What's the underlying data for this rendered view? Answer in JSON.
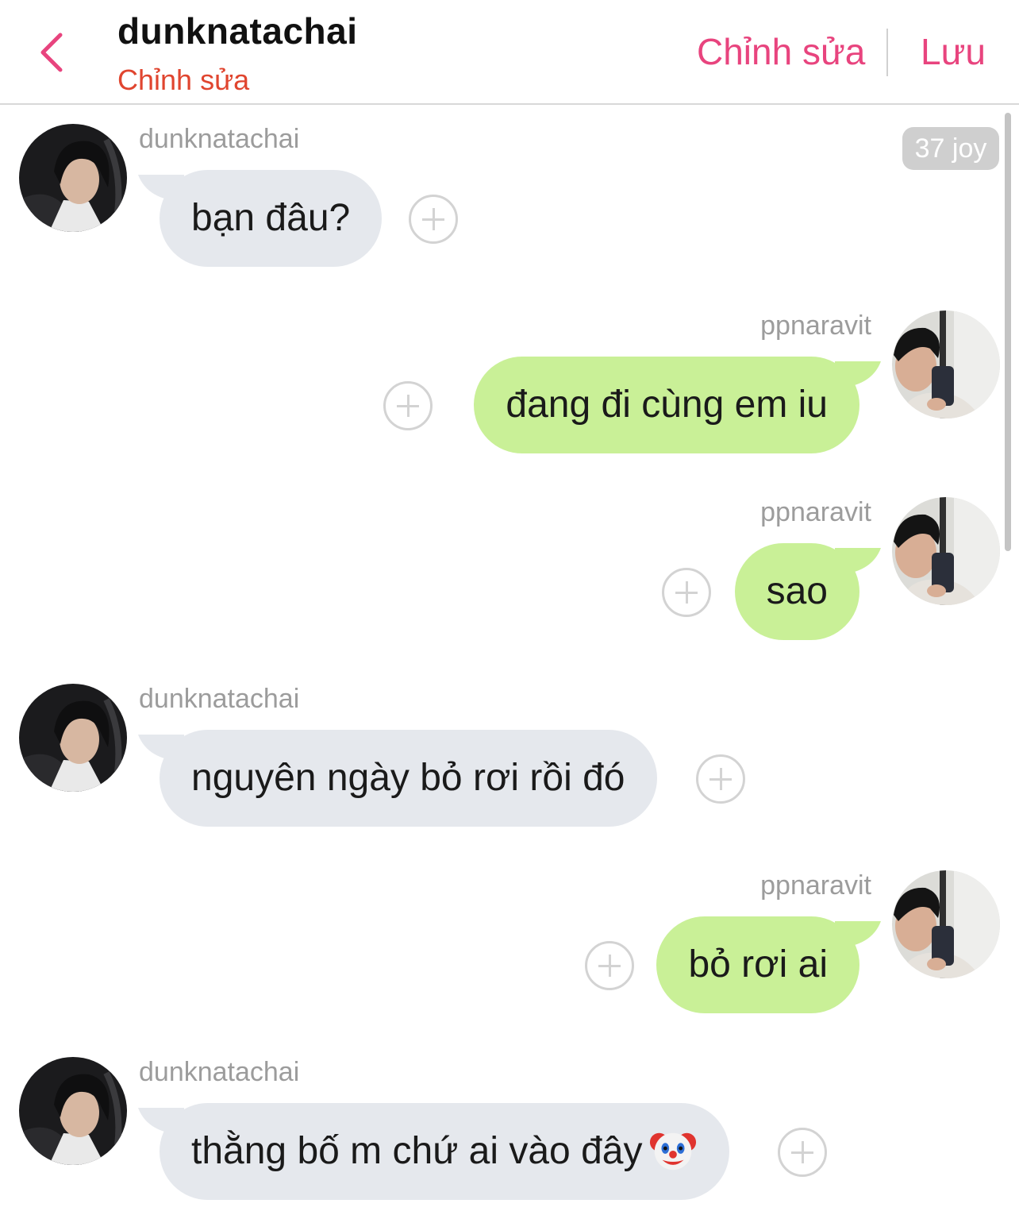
{
  "header": {
    "title": "dunknatachai",
    "subtitle": "Chỉnh sửa",
    "edit_label": "Chỉnh sửa",
    "save_label": "Lưu"
  },
  "badge": "37 joy",
  "colors": {
    "accent": "#e8447e",
    "subtitle": "#e0452f",
    "incoming_bubble": "#e5e8ed",
    "outgoing_bubble": "#c9f097"
  },
  "messages": [
    {
      "sender": "dunknatachai",
      "side": "left",
      "text": "bạn đâu?"
    },
    {
      "sender": "ppnaravit",
      "side": "right",
      "text": "đang đi cùng em iu"
    },
    {
      "sender": "ppnaravit",
      "side": "right",
      "text": "sao"
    },
    {
      "sender": "dunknatachai",
      "side": "left",
      "text": "nguyên ngày bỏ rơi rồi đó"
    },
    {
      "sender": "ppnaravit",
      "side": "right",
      "text": "bỏ rơi ai"
    },
    {
      "sender": "dunknatachai",
      "side": "left",
      "text": "thằng bố m chứ ai vào đây",
      "emoji": "clown-face"
    }
  ]
}
